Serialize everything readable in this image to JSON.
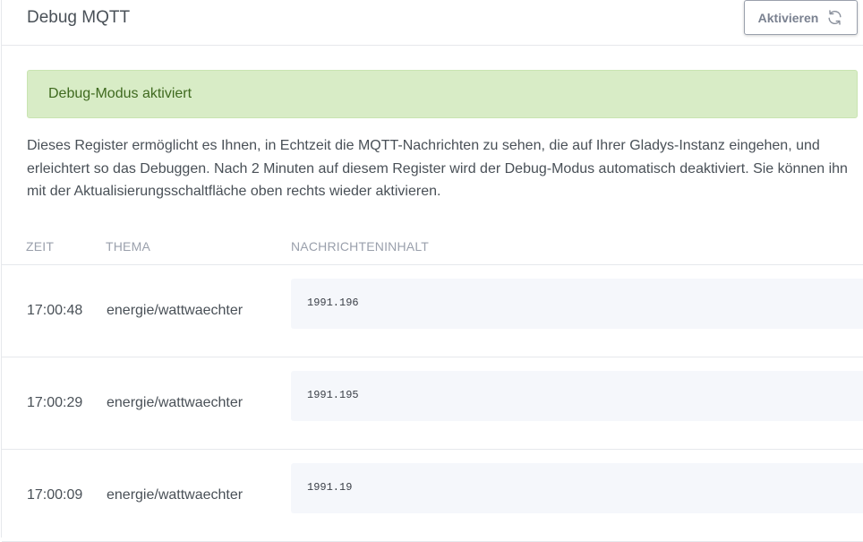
{
  "header": {
    "title": "Debug MQTT",
    "activate_label": "Aktivieren",
    "activate_icon": "refresh-icon"
  },
  "alert": {
    "text": "Debug-Modus aktiviert",
    "color": "#d8ecc6"
  },
  "description": "Dieses Register ermöglicht es Ihnen, in Echtzeit die MQTT-Nachrichten zu sehen, die auf Ihrer Gladys-Instanz eingehen, und erleichtert so das Debuggen. Nach 2 Minuten auf diesem Register wird der Debug-Modus automatisch deaktiviert. Sie können ihn mit der Aktualisierungsschaltfläche oben rechts wieder aktivieren.",
  "table": {
    "columns": [
      "ZEIT",
      "THEMA",
      "NACHRICHTENINHALT"
    ],
    "rows": [
      {
        "time": "17:00:48",
        "topic": "energie/wattwaechter",
        "content": "1991.196"
      },
      {
        "time": "17:00:29",
        "topic": "energie/wattwaechter",
        "content": "1991.195"
      },
      {
        "time": "17:00:09",
        "topic": "energie/wattwaechter",
        "content": "1991.19"
      }
    ]
  }
}
